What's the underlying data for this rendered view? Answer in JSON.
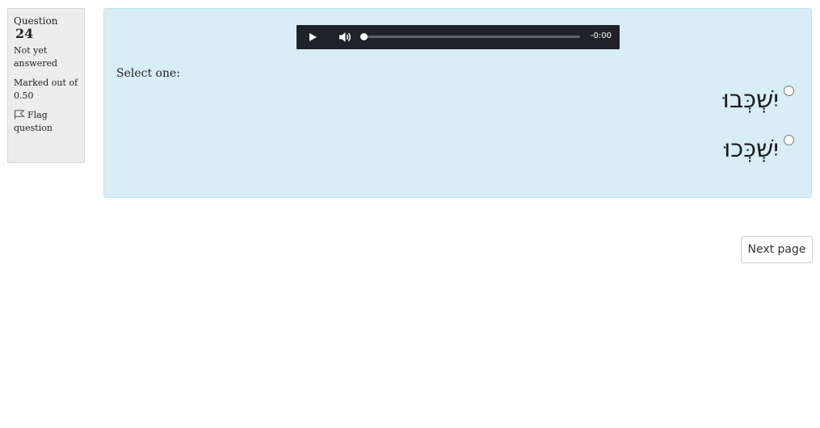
{
  "question": {
    "title_prefix": "Question",
    "number": "24",
    "state": "Not yet answered",
    "grade": "Marked out of 0.50",
    "flag_label": "Flag question"
  },
  "audio": {
    "time": "-0:00",
    "progress_fraction": 0,
    "play_icon": "play-icon",
    "volume_icon": "volume-icon"
  },
  "prompt": "Select one:",
  "options": [
    {
      "label": "יִשְׁכְּבוּ",
      "selected": false
    },
    {
      "label": "יִשְׁכְּכוּ",
      "selected": false
    }
  ],
  "navigation": {
    "next_label": "Next page"
  },
  "colors": {
    "content_bg": "#d9edf7",
    "info_bg": "#ededed",
    "player_bg": "#1f2328"
  }
}
